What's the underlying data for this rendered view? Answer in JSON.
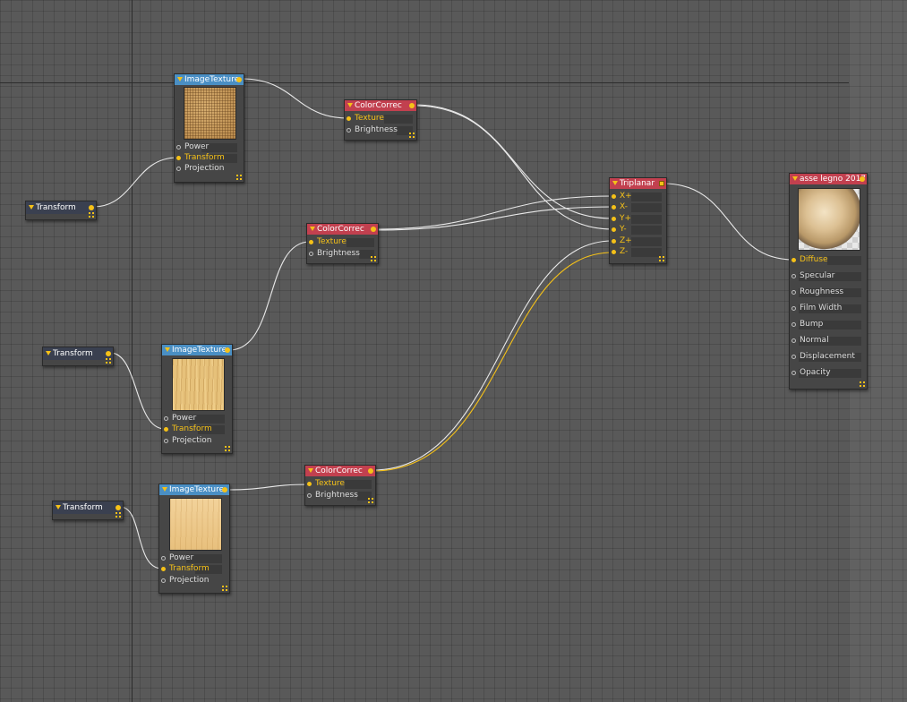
{
  "nodes": {
    "image_texture_1": {
      "title": "ImageTexture",
      "inputs": [
        "Power",
        "Transform",
        "Projection"
      ]
    },
    "image_texture_2": {
      "title": "ImageTexture",
      "inputs": [
        "Power",
        "Transform",
        "Projection"
      ]
    },
    "image_texture_3": {
      "title": "ImageTexture",
      "inputs": [
        "Power",
        "Transform",
        "Projection"
      ]
    },
    "color_correct_1": {
      "title": "ColorCorrec",
      "inputs": [
        "Texture",
        "Brightness"
      ]
    },
    "color_correct_2": {
      "title": "ColorCorrec",
      "inputs": [
        "Texture",
        "Brightness"
      ]
    },
    "color_correct_3": {
      "title": "ColorCorrec",
      "inputs": [
        "Texture",
        "Brightness"
      ]
    },
    "transform_1": {
      "title": "Transform"
    },
    "transform_2": {
      "title": "Transform"
    },
    "transform_3": {
      "title": "Transform"
    },
    "triplanar": {
      "title": "Triplanar",
      "inputs": [
        "X+",
        "X-",
        "Y+",
        "Y-",
        "Z+",
        "Z-"
      ]
    },
    "material": {
      "title": "asse legno 2017",
      "inputs": [
        "Diffuse",
        "Specular",
        "Roughness",
        "Film Width",
        "Bump",
        "Normal",
        "Displacement",
        "Opacity"
      ]
    }
  },
  "colors": {
    "texture_header": "#4a8fc4",
    "correction_header": "#c2404f",
    "transform_header": "#3a4050",
    "pin_active": "#f5c118",
    "wire": "#e8e8e8",
    "wire_selected": "#f5c118",
    "canvas": "#595959"
  },
  "icons": [
    "collapse-triangle-icon",
    "output-pin-icon",
    "resize-grip-icon",
    "sphere-preview-icon"
  ]
}
